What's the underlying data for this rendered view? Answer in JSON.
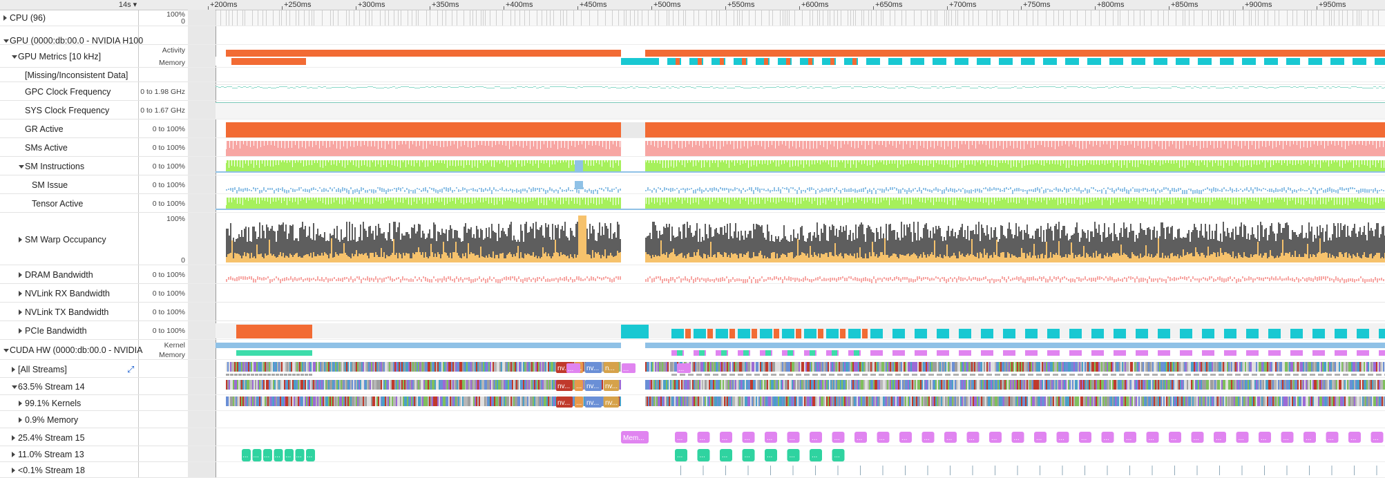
{
  "zoom": {
    "label": "14s",
    "caret": "▾"
  },
  "ticks": [
    "+200ms",
    "+250ms",
    "+300ms",
    "+350ms",
    "+400ms",
    "+450ms",
    "+500ms",
    "+550ms",
    "+600ms",
    "+650ms",
    "+700ms",
    "+750ms",
    "+800ms",
    "+850ms",
    "+900ms",
    "+950ms"
  ],
  "rows": [
    {
      "id": "cpu",
      "label": "CPU (96)",
      "indent": 0,
      "toggle": "right",
      "scale_top": "100%",
      "scale_bottom": "0"
    },
    {
      "id": "gpu",
      "label": "GPU (0000:db:00.0 - NVIDIA H100",
      "indent": 0,
      "toggle": "down"
    },
    {
      "id": "gpu-metrics",
      "label": "GPU Metrics [10 kHz]",
      "indent": 1,
      "toggle": "down",
      "scale_top": "Activity",
      "scale_bottom": "Memory"
    },
    {
      "id": "missing",
      "label": "[Missing/Inconsistent Data]",
      "indent": 2,
      "toggle": "none"
    },
    {
      "id": "gpc-clock",
      "label": "GPC Clock Frequency",
      "indent": 2,
      "toggle": "none",
      "scale": "0 to 1.98 GHz"
    },
    {
      "id": "sys-clock",
      "label": "SYS Clock Frequency",
      "indent": 2,
      "toggle": "none",
      "scale": "0 to 1.67 GHz"
    },
    {
      "id": "gr-active",
      "label": "GR Active",
      "indent": 2,
      "toggle": "none",
      "scale": "0 to 100%"
    },
    {
      "id": "sms-active",
      "label": "SMs Active",
      "indent": 2,
      "toggle": "none",
      "scale": "0 to 100%"
    },
    {
      "id": "sm-instructions",
      "label": "SM Instructions",
      "indent": 2,
      "toggle": "down",
      "scale": "0 to 100%"
    },
    {
      "id": "sm-issue",
      "label": "SM Issue",
      "indent": 3,
      "toggle": "none",
      "scale": "0 to 100%"
    },
    {
      "id": "tensor-active",
      "label": "Tensor Active",
      "indent": 3,
      "toggle": "none",
      "scale": "0 to 100%"
    },
    {
      "id": "sm-warp",
      "label": "SM Warp Occupancy",
      "indent": 2,
      "toggle": "right",
      "scale_top": "100%",
      "scale_bottom": "0"
    },
    {
      "id": "dram",
      "label": "DRAM Bandwidth",
      "indent": 2,
      "toggle": "right",
      "scale": "0 to 100%"
    },
    {
      "id": "nvlink-rx",
      "label": "NVLink RX Bandwidth",
      "indent": 2,
      "toggle": "right",
      "scale": "0 to 100%"
    },
    {
      "id": "nvlink-tx",
      "label": "NVLink TX Bandwidth",
      "indent": 2,
      "toggle": "right",
      "scale": "0 to 100%"
    },
    {
      "id": "pcie",
      "label": "PCIe Bandwidth",
      "indent": 2,
      "toggle": "right",
      "scale": "0 to 100%"
    },
    {
      "id": "cuda-hw",
      "label": "CUDA HW (0000:db:00.0 - NVIDIA",
      "indent": 0,
      "toggle": "down",
      "scale_top": "Kernel",
      "scale_bottom": "Memory"
    },
    {
      "id": "all-streams",
      "label": "[All Streams]",
      "indent": 1,
      "toggle": "right"
    },
    {
      "id": "stream14",
      "label": "63.5% Stream 14",
      "indent": 1,
      "toggle": "down"
    },
    {
      "id": "kernels",
      "label": "99.1% Kernels",
      "indent": 2,
      "toggle": "right"
    },
    {
      "id": "memory",
      "label": "0.9% Memory",
      "indent": 2,
      "toggle": "right"
    },
    {
      "id": "stream15",
      "label": "25.4% Stream 15",
      "indent": 1,
      "toggle": "right"
    },
    {
      "id": "stream13",
      "label": "11.0% Stream 13",
      "indent": 1,
      "toggle": "right"
    },
    {
      "id": "stream18",
      "label": "<0.1% Stream 18",
      "indent": 1,
      "toggle": "right"
    }
  ],
  "kernel_labels": {
    "nv": "nv...",
    "ellipsis": "...",
    "n": "n...",
    "mem": "Mem..."
  },
  "colors": {
    "orange": "#f26b34",
    "teal": "#19c8d2",
    "salmon": "#f7a6a3",
    "green": "#a6f05c",
    "blue": "#8fc1e6",
    "dark": "#5e5e5e",
    "gold": "#f6c26c",
    "violet": "#e084f0",
    "sea": "#3ddcaa",
    "navy": "#1a73e8"
  }
}
